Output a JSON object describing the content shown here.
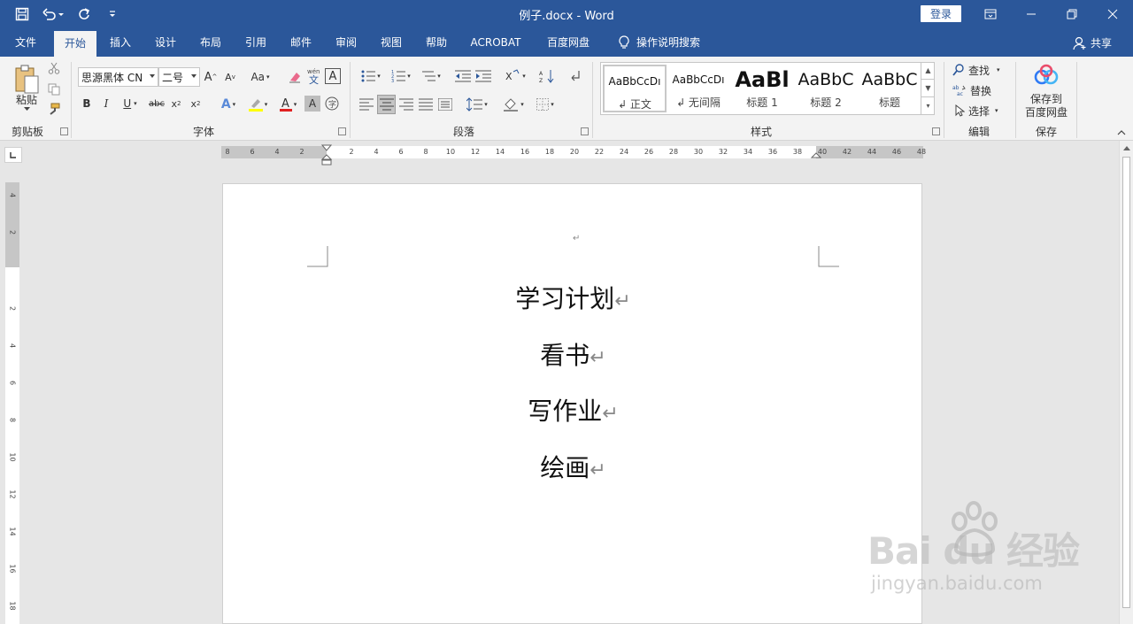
{
  "window": {
    "title": "例子.docx  -  Word",
    "login_label": "登录"
  },
  "tabs": [
    "文件",
    "开始",
    "插入",
    "设计",
    "布局",
    "引用",
    "邮件",
    "审阅",
    "视图",
    "帮助",
    "ACROBAT",
    "百度网盘",
    "操作说明搜索"
  ],
  "active_tab": "开始",
  "share_label": "共享",
  "ribbon": {
    "clipboard": {
      "paste_label": "粘贴",
      "group_label": "剪贴板"
    },
    "font": {
      "font_name": "思源黑体 CN",
      "font_size": "二号",
      "change_case_label": "Aa",
      "group_label": "字体"
    },
    "paragraph": {
      "group_label": "段落"
    },
    "styles": {
      "group_label": "样式",
      "items": [
        {
          "sample": "AaBbCcDı",
          "name": "↲ 正文"
        },
        {
          "sample": "AaBbCcDı",
          "name": "↲ 无间隔"
        },
        {
          "sample": "AaBl",
          "name": "标题 1"
        },
        {
          "sample": "AaBbC",
          "name": "标题 2"
        },
        {
          "sample": "AaBbC",
          "name": "标题"
        }
      ]
    },
    "editing": {
      "find_label": "查找",
      "replace_label": "替换",
      "select_label": "选择",
      "group_label": "编辑"
    },
    "save": {
      "button_line1": "保存到",
      "button_line2": "百度网盘",
      "group_label": "保存"
    }
  },
  "ruler": {
    "h_ticks": [
      "8",
      "6",
      "4",
      "2",
      "2",
      "4",
      "6",
      "8",
      "10",
      "12",
      "14",
      "16",
      "18",
      "20",
      "22",
      "24",
      "26",
      "28",
      "30",
      "32",
      "34",
      "36",
      "38",
      "40",
      "42",
      "44",
      "46",
      "48"
    ],
    "v_ticks": [
      "4",
      "2",
      "2",
      "4",
      "6",
      "8",
      "10",
      "12",
      "14",
      "16",
      "18"
    ]
  },
  "document": {
    "lines": [
      "学习计划",
      "看书",
      "写作业",
      "绘画"
    ],
    "paragraph_mark": "↵"
  },
  "watermark": {
    "logo": "Bai du 经验",
    "url": "jingyan.baidu.com"
  },
  "colors": {
    "accent": "#2b579a",
    "ribbon_bg": "#f3f3f3",
    "canvas_bg": "#e6e6e6"
  }
}
